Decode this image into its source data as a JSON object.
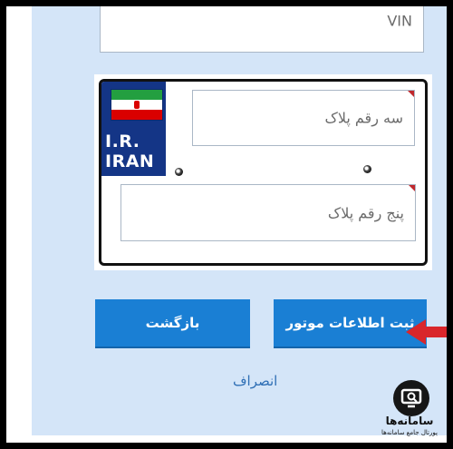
{
  "form": {
    "vin_placeholder": "VIN",
    "plate": {
      "country_line1": "I.R.",
      "country_line2": "IRAN",
      "three_digit_placeholder": "سه رقم پلاک",
      "five_digit_placeholder": "پنج رقم پلاک"
    },
    "buttons": {
      "submit_label": "ثبت اطلاعات موتور",
      "back_label": "بازگشت"
    },
    "cancel_link": "انصراف"
  },
  "watermark": {
    "title": "سامانه‌ها",
    "subtitle": "پورتال جامع سامانه‌ها"
  },
  "colors": {
    "panel_bg": "#d4e5f8",
    "button_bg": "#1a7fd4",
    "plate_strip": "#143586",
    "arrow": "#d9262b",
    "required_marker": "#c0282d",
    "link": "#2f6fb5"
  },
  "icons": {
    "arrow": "arrow-right-icon",
    "flag": "iran-flag-icon",
    "screw": "screw-icon",
    "logo": "samaneha-logo-icon"
  }
}
